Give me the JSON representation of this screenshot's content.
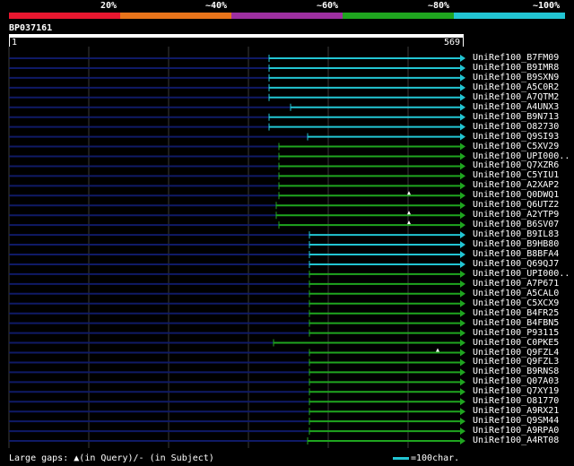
{
  "legend": {
    "labels": [
      "20%",
      "~40%",
      "~60%",
      "~80%",
      "~100%"
    ],
    "colors": [
      "#e8172f",
      "#e8741a",
      "#9d2fa0",
      "#1fa51f",
      "#22c5d3"
    ]
  },
  "query": {
    "id": "BP037161",
    "start": "1",
    "end": "569"
  },
  "hits": [
    {
      "name": "UniRef100_B7FM09",
      "color": "cyan"
    },
    {
      "name": "UniRef100_B9IMR8",
      "color": "cyan"
    },
    {
      "name": "UniRef100_B9SXN9",
      "color": "cyan"
    },
    {
      "name": "UniRef100_A5C0R2",
      "color": "cyan"
    },
    {
      "name": "UniRef100_A7QTM2",
      "color": "cyan"
    },
    {
      "name": "UniRef100_A4UNX3",
      "color": "cyan"
    },
    {
      "name": "UniRef100_B9N713",
      "color": "cyan"
    },
    {
      "name": "UniRef100_O82730",
      "color": "cyan"
    },
    {
      "name": "UniRef100_Q9SI93",
      "color": "cyan"
    },
    {
      "name": "UniRef100_C5XV29",
      "color": "green"
    },
    {
      "name": "UniRef100_UPI000..",
      "color": "green"
    },
    {
      "name": "UniRef100_Q7XZR6",
      "color": "green"
    },
    {
      "name": "UniRef100_C5YIU1",
      "color": "green"
    },
    {
      "name": "UniRef100_A2XAP2",
      "color": "green"
    },
    {
      "name": "UniRef100_Q0DWQ1",
      "color": "green"
    },
    {
      "name": "UniRef100_Q6UTZ2",
      "color": "green"
    },
    {
      "name": "UniRef100_A2YTP9",
      "color": "green"
    },
    {
      "name": "UniRef100_B6SV07",
      "color": "green"
    },
    {
      "name": "UniRef100_B9IL83",
      "color": "cyan"
    },
    {
      "name": "UniRef100_B9HB80",
      "color": "cyan"
    },
    {
      "name": "UniRef100_B8BFA4",
      "color": "cyan"
    },
    {
      "name": "UniRef100_Q69QJ7",
      "color": "cyan"
    },
    {
      "name": "UniRef100_UPI000..",
      "color": "green"
    },
    {
      "name": "UniRef100_A7P671",
      "color": "green"
    },
    {
      "name": "UniRef100_A5CAL0",
      "color": "green"
    },
    {
      "name": "UniRef100_C5XCX9",
      "color": "green"
    },
    {
      "name": "UniRef100_B4FR25",
      "color": "green"
    },
    {
      "name": "UniRef100_B4FBN5",
      "color": "green"
    },
    {
      "name": "UniRef100_P93115",
      "color": "green"
    },
    {
      "name": "UniRef100_C0PKE5",
      "color": "green"
    },
    {
      "name": "UniRef100_Q9FZL4",
      "color": "green"
    },
    {
      "name": "UniRef100_Q9FZL3",
      "color": "green"
    },
    {
      "name": "UniRef100_B9RNS8",
      "color": "green"
    },
    {
      "name": "UniRef100_Q07A03",
      "color": "green"
    },
    {
      "name": "UniRef100_Q7XY19",
      "color": "green"
    },
    {
      "name": "UniRef100_O81770",
      "color": "green"
    },
    {
      "name": "UniRef100_A9RX21",
      "color": "green"
    },
    {
      "name": "UniRef100_Q9SM44",
      "color": "green"
    },
    {
      "name": "UniRef100_A9RPA0",
      "color": "green"
    },
    {
      "name": "UniRef100_A4RT08",
      "color": "green"
    }
  ],
  "footer": {
    "gaps_prefix": "Large gaps:",
    "gaps_query": "(in Query)/",
    "gaps_subject": "- (in Subject)",
    "scale_text": "=100char."
  }
}
